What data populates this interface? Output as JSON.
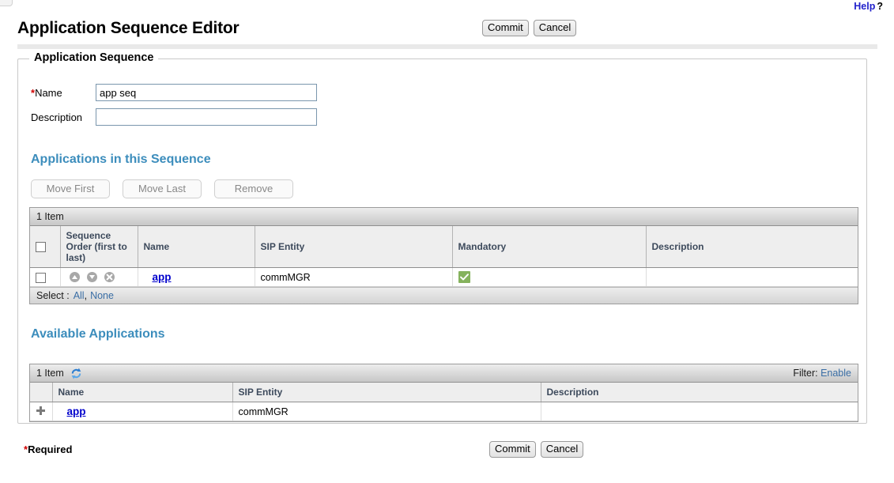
{
  "header": {
    "help_label": "Help",
    "help_qmark": "?",
    "page_title": "Application Sequence Editor",
    "commit_label": "Commit",
    "cancel_label": "Cancel"
  },
  "fieldset": {
    "legend": "Application Sequence",
    "name_label": "Name",
    "name_required_star": "*",
    "name_value": "app seq",
    "description_label": "Description",
    "description_value": ""
  },
  "sequence_section": {
    "heading": "Applications in this Sequence",
    "buttons": [
      {
        "label": "Move First",
        "name": "move-first-button",
        "disabled": true
      },
      {
        "label": "Move Last",
        "name": "move-last-button",
        "disabled": true
      },
      {
        "label": "Remove",
        "name": "remove-button",
        "disabled": true
      }
    ],
    "item_count": "1 Item",
    "columns": [
      "",
      "Sequence Order (first to last)",
      "Name",
      "SIP Entity",
      "Mandatory",
      "Description"
    ],
    "rows": [
      {
        "selected": false,
        "order_icons": [
          "move-up-icon",
          "move-down-icon",
          "delete-x-icon"
        ],
        "name": "app",
        "sip_entity": "commMGR",
        "mandatory": true,
        "description": ""
      }
    ],
    "footer_select_label": "Select :",
    "footer_all": "All",
    "footer_comma": ",",
    "footer_none": "None"
  },
  "available_section": {
    "heading": "Available Applications",
    "item_count": "1 Item",
    "refresh_icon": "refresh-icon",
    "filter_label": "Filter:",
    "filter_action": "Enable",
    "columns": [
      "",
      "Name",
      "SIP Entity",
      "Description"
    ],
    "rows": [
      {
        "add_icon": "add-plus-icon",
        "name": "app",
        "sip_entity": "commMGR",
        "description": ""
      }
    ]
  },
  "footer": {
    "required_star": "*",
    "required_label": "Required",
    "commit_label": "Commit",
    "cancel_label": "Cancel"
  },
  "colors": {
    "accent_heading": "#3c8dbc",
    "link": "#0000cc",
    "help_link": "#2222cc",
    "required_star": "#d00000",
    "mandatory_check": "#85b25d",
    "table_header_text": "#3d4a5c"
  }
}
